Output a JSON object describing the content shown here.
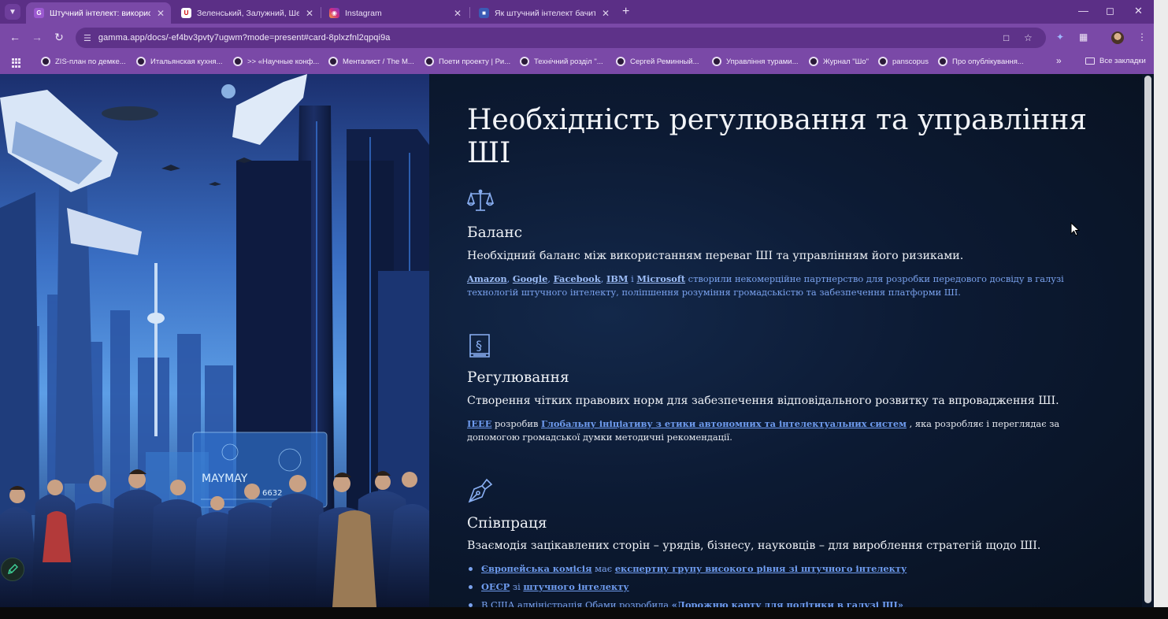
{
  "browser": {
    "tabs": [
      {
        "title": "Штучний інтелект: використа",
        "favicon": "gamma-icon",
        "active": true
      },
      {
        "title": "Зеленський, Залужний, Шевче",
        "favicon": "news-icon",
        "active": false
      },
      {
        "title": "Instagram",
        "favicon": "instagram-icon",
        "active": false
      },
      {
        "title": "Як штучний інтелект бачить в",
        "favicon": "site-icon",
        "active": false
      }
    ],
    "url": "gamma.app/docs/-ef4bv3pvty7ugwm?mode=present#card-8plxzfnl2qpqi9a",
    "bookmarks": [
      "ZIS-план по демке...",
      "Итальянская кухня...",
      ">> «Научные конф...",
      "Менталист / The M...",
      "Поети проекту | Ри...",
      "Технічний розділ \"...",
      "Сергей Реминный...",
      "Управління турами...",
      "Журнал \"Шо\"",
      "panscopus",
      "Про опублікування..."
    ],
    "all_bookmarks_label": "Все закладки",
    "colors": {
      "frame": "#5b2f86",
      "toolbar": "#7a49a7"
    }
  },
  "page": {
    "title": "Необхідність регулювання та управління ШІ",
    "sections": [
      {
        "icon": "scales-icon",
        "heading": "Баланс",
        "lead": "Необхідний баланс між використанням переваг ШІ та управлінням його ризиками.",
        "links": [
          "Amazon",
          "Google",
          "Facebook",
          "IBM",
          "Microsoft"
        ],
        "sep_comma": ", ",
        "sep_and": " і ",
        "body": " створили некомерційне партнерство для розробки передового досвіду в галузі технологій штучного інтелекту, поліпшення розуміння громадськістю та забезпечення платформи ШІ."
      },
      {
        "icon": "law-book-icon",
        "heading": "Регулювання",
        "lead": "Створення чітких правових норм для забезпечення відповідального розвитку та впровадження ШІ.",
        "link1": "IEEE",
        "mid": " розробив ",
        "link2": "Глобальну ініціативу з етики автономних та інтелектуальних систем",
        "body": " , яка розробляє і переглядає за допомогою громадської думки методичні рекомендації."
      },
      {
        "icon": "fountain-pen-icon",
        "heading": "Співпраця",
        "lead": "Взаємодія зацікавлених сторін – урядів, бізнесу, науковців – для вироблення стратегій щодо ШІ.",
        "bullets": [
          {
            "link1": "Європейська комісія",
            "text": " має ",
            "link2": "експертну групу високого рівня зі штучного інтелекту"
          },
          {
            "link1": "ОЕСР",
            "text": " зі ",
            "link2": "штучного інтелекту"
          },
          {
            "link1": "",
            "text": "В США адміністрація Обами розробила ",
            "link2": "«Дорожню карту для політики в галузі ШІ»"
          }
        ]
      }
    ],
    "hero_sign": "MAYMAY",
    "hero_number": "6632"
  }
}
